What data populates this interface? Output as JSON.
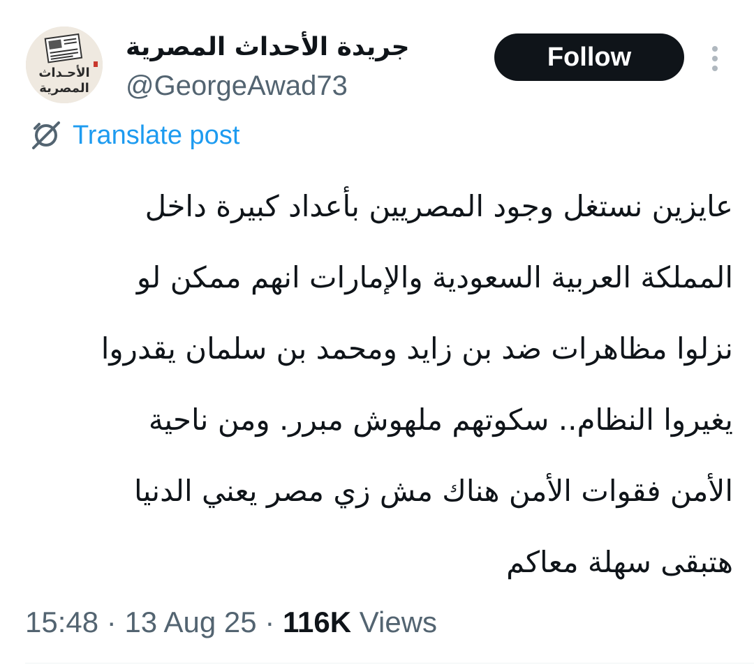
{
  "author": {
    "display_name": "جريدة الأحداث المصرية",
    "handle": "@GeorgeAwad73",
    "avatar_text_top": "الأحـداث",
    "avatar_text_bottom": "المصرية"
  },
  "follow_button": {
    "label": "Follow"
  },
  "translate": {
    "label": "Translate post",
    "icon": "translate-icon"
  },
  "more_icon": "more-vertical-icon",
  "tweet": {
    "lines": [
      "عايزين نستغل وجود المصريين بأعداد كبيرة داخل",
      "المملكة العربية السعودية والإمارات انهم ممكن لو",
      "نزلوا مظاهرات ضد بن زايد ومحمد بن سلمان يقدروا",
      "يغيروا النظام.. سكوتهم ملهوش مبرر. ومن ناحية",
      "الأمن فقوات الأمن هناك مش زي مصر يعني الدنيا",
      "هتبقى سهلة معاكم"
    ]
  },
  "meta": {
    "time": "15:48",
    "separator": "·",
    "date": "13 Aug 25",
    "views_count": "116K",
    "views_label": "Views"
  },
  "colors": {
    "text": "#0f1419",
    "secondary": "#536471",
    "link": "#1d9bf0",
    "button_bg": "#0f1419",
    "button_text": "#ffffff"
  }
}
